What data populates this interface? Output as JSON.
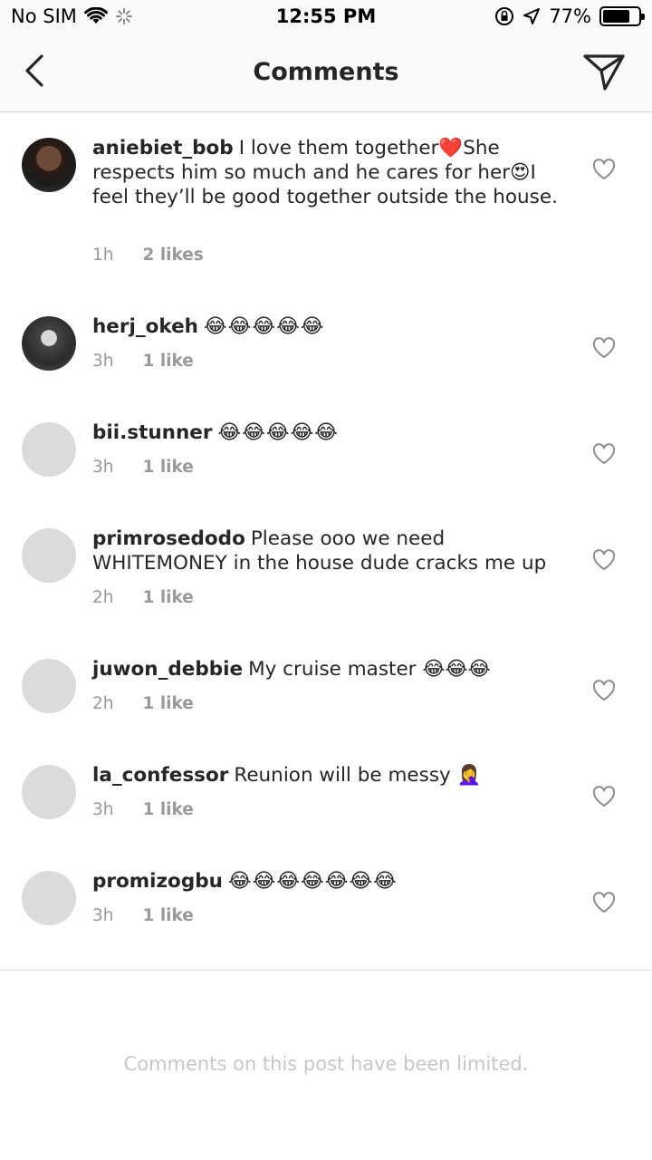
{
  "status_bar": {
    "carrier": "No SIM",
    "time": "12:55 PM",
    "battery": "77%",
    "battery_level": 0.77
  },
  "nav": {
    "title": "Comments",
    "back_icon": "chevron-left-icon",
    "send_icon": "paper-plane-icon"
  },
  "comments": [
    {
      "user": "aniebiet_bob",
      "text": "I love them together❤️She respects him so much and he cares for her😍I feel they’ll be good together outside the house.",
      "time": "1h",
      "likes": "2 likes"
    },
    {
      "user": "herj_okeh",
      "text": "😂😂😂😂😂",
      "time": "3h",
      "likes": "1 like"
    },
    {
      "user": "bii.stunner",
      "text": "😂😂😂😂😂",
      "time": "3h",
      "likes": "1 like"
    },
    {
      "user": "primrosedodo",
      "text": "Please ooo we need WHITEMONEY in the house dude cracks me up",
      "time": "2h",
      "likes": "1 like"
    },
    {
      "user": "juwon_debbie",
      "text": "My cruise master 😂😂😂",
      "time": "2h",
      "likes": "1 like"
    },
    {
      "user": "la_confessor",
      "text": "Reunion will be messy 🤦‍♀️",
      "time": "3h",
      "likes": "1 like"
    },
    {
      "user": "promizogbu",
      "text": "😂😂😂😂😂😂😂",
      "time": "3h",
      "likes": "1 like"
    }
  ],
  "footer": {
    "limited_text": "Comments on this post have been limited."
  },
  "colors": {
    "text": "#262626",
    "meta": "#999999",
    "bar_bg": "#f9f9f9",
    "placeholder_avatar": "#dbdbdb"
  }
}
